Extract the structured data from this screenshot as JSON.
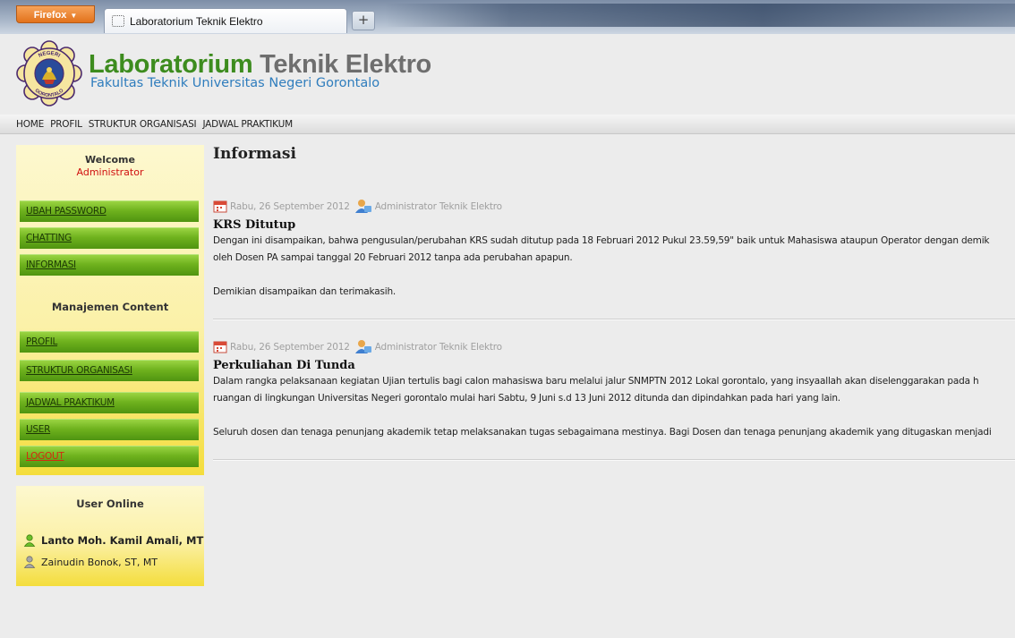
{
  "browser": {
    "menu_button": "Firefox",
    "tab_title": "Laboratorium Teknik Elektro",
    "new_tab": "+"
  },
  "header": {
    "title_part1": "Laboratorium",
    "title_part2": "Teknik Elektro",
    "subtitle": "Fakultas Teknik Universitas Negeri Gorontalo",
    "logo_text_top": "NEGERI",
    "logo_text_left": "UNIVERSITAS",
    "logo_text_bottom": "GORONTALO"
  },
  "nav": {
    "items": [
      "HOME",
      "PROFIL",
      "STRUKTUR ORGANISASI",
      "JADWAL PRAKTIKUM"
    ]
  },
  "sidebar": {
    "welcome": "Welcome",
    "user": "Administrator",
    "menu": [
      "UBAH PASSWORD",
      "CHATTING",
      "INFORMASI"
    ],
    "content_title": "Manajemen Content",
    "content_menu": [
      "PROFIL",
      "STRUKTUR ORGANISASI",
      "JADWAL PRAKTIKUM",
      "USER",
      "LOGOUT"
    ],
    "online_title": "User Online",
    "online_users": [
      {
        "name": "Lanto Moh. Kamil Amali, MT",
        "status": "online"
      },
      {
        "name": "Zainudin Bonok, ST, MT",
        "status": "offline"
      }
    ]
  },
  "main": {
    "heading": "Informasi",
    "articles": [
      {
        "date": "Rabu, 26 September 2012",
        "author": "Administrator Teknik Elektro",
        "title": "KRS Ditutup",
        "lines": [
          "Dengan ini disampaikan, bahwa pengusulan/perubahan KRS sudah ditutup pada 18 Februari 2012 Pukul 23.59,59\" baik untuk Mahasiswa ataupun Operator dengan demik",
          "oleh Dosen PA sampai tanggal 20 Februari 2012 tanpa ada perubahan apapun."
        ],
        "closing": "Demikian disampaikan dan terimakasih."
      },
      {
        "date": "Rabu, 26 September 2012",
        "author": "Administrator Teknik Elektro",
        "title": "Perkuliahan Di Tunda",
        "lines": [
          "Dalam rangka pelaksanaan kegiatan Ujian tertulis bagi calon mahasiswa baru melalui jalur SNMPTN 2012 Lokal gorontalo, yang insyaallah akan diselenggarakan pada h",
          "ruangan di lingkungan Universitas Negeri gorontalo mulai hari Sabtu, 9 Juni s.d 13 Juni 2012 ditunda dan dipindahkan pada hari yang lain."
        ],
        "closing": "Seluruh dosen dan tenaga penunjang akademik tetap melaksanakan tugas sebagaimana mestinya. Bagi Dosen dan tenaga penunjang akademik yang ditugaskan menjadi"
      }
    ]
  },
  "colors": {
    "title_green": "#3d8c1e",
    "title_gray": "#6e6e6e",
    "subtitle_blue": "#2f7dbd",
    "menu_green": "#6fb21e",
    "panel_yellow": "#f4dd3c",
    "logout_red": "#d32a10",
    "admin_red": "#d01010"
  },
  "icons": {
    "date": "calendar-icon",
    "author": "admin-user-icon",
    "online": "user-online-icon",
    "offline": "user-offline-icon"
  }
}
